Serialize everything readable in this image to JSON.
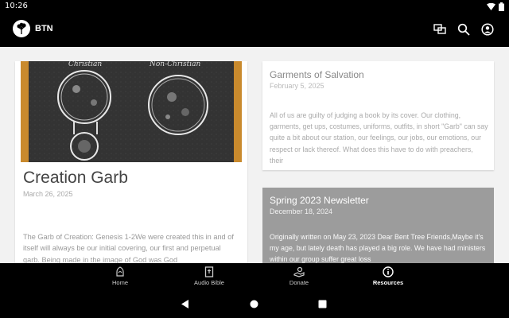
{
  "status": {
    "time": "10:26"
  },
  "app": {
    "brand": "BTN"
  },
  "toolbar_icons": [
    "chat-icon",
    "search-icon",
    "account-icon"
  ],
  "posts": [
    {
      "title": "Creation Garb",
      "date": "March 26, 2025",
      "excerpt": "The Garb of Creation: Genesis 1-2We were created this in and of itself will always be our initial covering, our first and perpetual garb.  Being made in the image of God was God",
      "image_labels": {
        "left": "Christian",
        "right": "Non-Christian"
      }
    },
    {
      "title": "Garments of Salvation",
      "date": "February 5, 2025",
      "excerpt": "All of us are guilty of judging a book by its cover.  Our clothing, garments, get ups, costumes, uniforms, outfits, in short \"Garb\" can say quite a bit about our station, our feelings, our jobs, our emotions, our respect or lack thereof.   What does this have to do with preachers, their"
    },
    {
      "title": "Spring 2023 Newsletter",
      "date": "December 18, 2024",
      "excerpt": "Originally written on May 23, 2023 Dear Bent Tree Friends,Maybe it's my age, but lately death has played a big role.  We have had ministers within our group suffer great loss"
    }
  ],
  "nav": {
    "items": [
      {
        "label": "Home",
        "icon": "home-icon",
        "active": false
      },
      {
        "label": "Audio Bible",
        "icon": "bible-icon",
        "active": false
      },
      {
        "label": "Donate",
        "icon": "donate-icon",
        "active": false
      },
      {
        "label": "Resources",
        "icon": "info-icon",
        "active": true
      }
    ]
  },
  "colors": {
    "accent_card": "#9c9c9c",
    "bar": "#000000",
    "background": "#f2f2f2"
  }
}
